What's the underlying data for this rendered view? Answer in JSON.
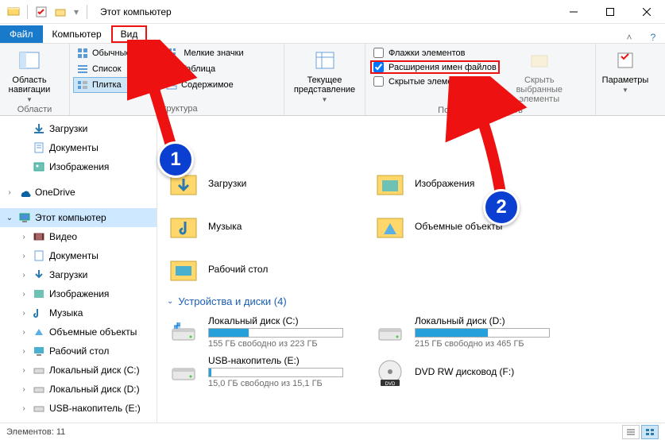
{
  "titlebar": {
    "title": "Этот компьютер",
    "min": "–",
    "max": "☐",
    "close": "✕"
  },
  "tabs": {
    "file": "Файл",
    "computer": "Компьютер",
    "view": "Вид"
  },
  "ribbon": {
    "panes_group": "Области",
    "nav_pane": "Область навигации",
    "layout_group": "Структура",
    "layouts": {
      "large": "Обычные значки",
      "small": "Мелкие значки",
      "list": "Список",
      "table": "Таблица",
      "tiles": "Плитка",
      "content": "Содержимое"
    },
    "current_view": "Текущее представление",
    "show_hide_group": "Показать или скрыть",
    "chk_itemcheck": "Флажки элементов",
    "chk_ext": "Расширения имен файлов",
    "chk_hidden": "Скрытые элементы",
    "hide_selected": "Скрыть выбранные элементы",
    "options": "Параметры"
  },
  "nav": {
    "downloads": "Загрузки",
    "documents": "Документы",
    "pictures": "Изображения",
    "onedrive": "OneDrive",
    "thispc": "Этот компьютер",
    "video": "Видео",
    "music": "Музыка",
    "volumes": "Объемные объекты",
    "desktop": "Рабочий стол",
    "driveC": "Локальный диск (C:)",
    "driveD": "Локальный диск (D:)",
    "driveE": "USB-накопитель (E:)"
  },
  "content": {
    "folders": {
      "downloads": "Загрузки",
      "pictures": "Изображения",
      "music": "Музыка",
      "volumes": "Объемные объекты",
      "desktop": "Рабочий стол"
    },
    "section_drives": "Устройства и диски (4)",
    "drives": [
      {
        "name": "Локальный диск (C:)",
        "sub": "155 ГБ свободно из 223 ГБ",
        "fill": 30
      },
      {
        "name": "Локальный диск (D:)",
        "sub": "215 ГБ свободно из 465 ГБ",
        "fill": 54
      },
      {
        "name": "USB-накопитель (E:)",
        "sub": "15,0 ГБ свободно из 15,1 ГБ",
        "fill": 2
      },
      {
        "name": "DVD RW дисковод (F:)",
        "sub": "",
        "fill": 0
      }
    ]
  },
  "status": {
    "elements": "Элементов: 11"
  },
  "annotations": {
    "one": "1",
    "two": "2"
  }
}
